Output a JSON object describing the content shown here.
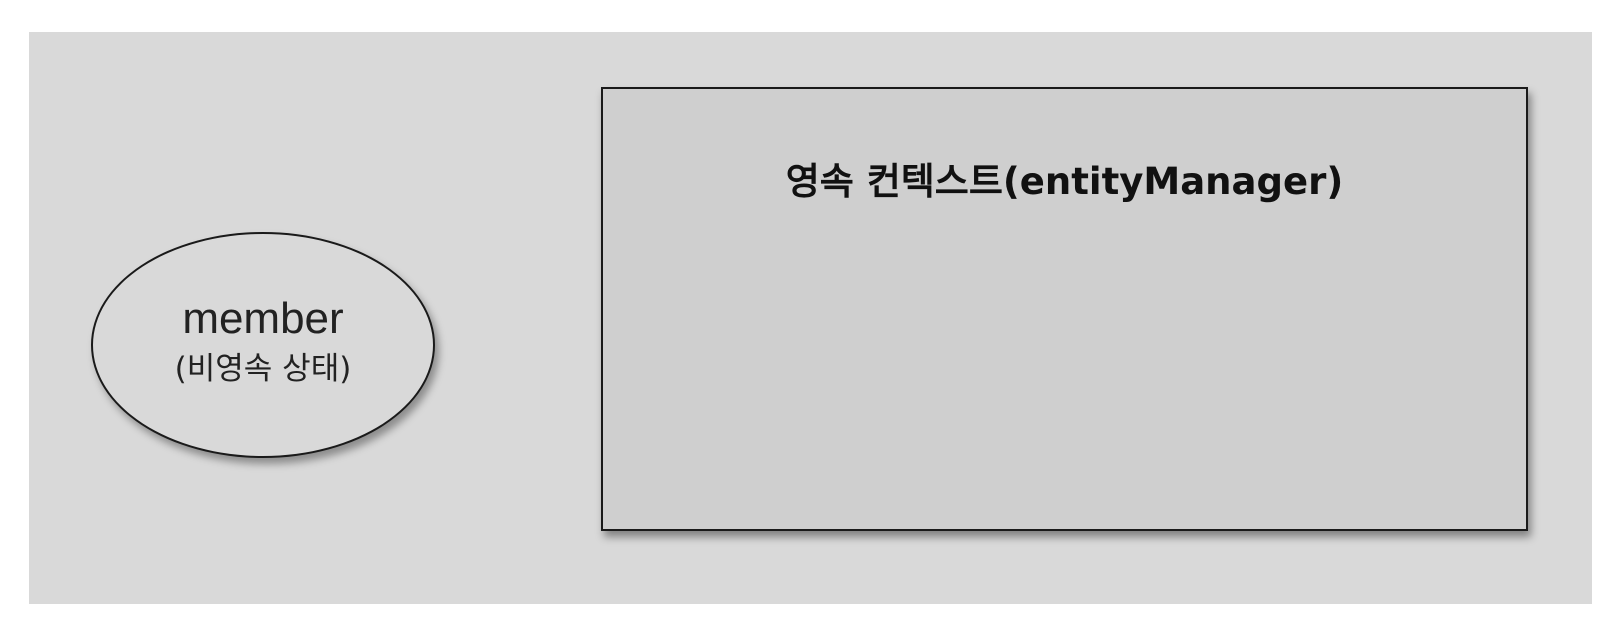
{
  "diagram": {
    "entity": {
      "name": "member",
      "state": "(비영속 상태)"
    },
    "context": {
      "title": "영속 컨텍스트(entityManager)"
    }
  }
}
